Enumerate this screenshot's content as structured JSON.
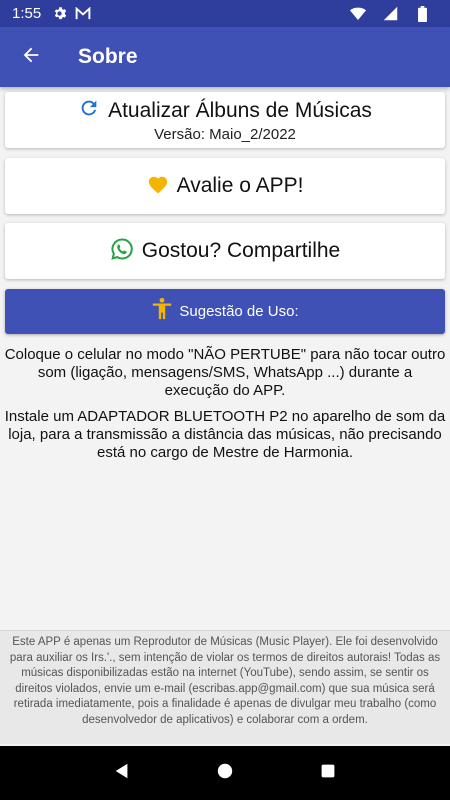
{
  "status_bar": {
    "time": "1:55",
    "icons_left": [
      "gear-icon",
      "gmail-icon"
    ],
    "icons_right": [
      "wifi-icon",
      "signal-icon",
      "battery-icon"
    ]
  },
  "app_bar": {
    "title": "Sobre",
    "back_icon": "arrow-back-icon",
    "color": "#3f51b5"
  },
  "cards": {
    "update": {
      "icon": "refresh-icon",
      "label": "Atualizar Álbuns de Músicas",
      "version": "Versão: Maio_2/2022"
    },
    "rate": {
      "icon": "heart-icon",
      "label": "Avalie o APP!"
    },
    "share": {
      "icon": "whatsapp-icon",
      "label": "Gostou? Compartilhe"
    }
  },
  "suggestion": {
    "icon": "accessibility-icon",
    "label": "Sugestão de Uso:"
  },
  "paragraphs": [
    "Coloque o celular no modo \"NÃO PERTUBE\" para não tocar outro som (ligação, mensagens/SMS, WhatsApp ...) durante a execução do APP.",
    "Instale um ADAPTADOR BLUETOOTH P2 no aparelho de som da loja, para a transmissão a distância das músicas, não precisando está no cargo de Mestre de Harmonia."
  ],
  "disclaimer": "Este APP é apenas um Reprodutor de Músicas (Music Player). Ele foi desenvolvido para auxiliar os Irs.'., sem intenção de violar os termos de direitos autorais! Todas as músicas disponibilizadas estão na internet (YouTube), sendo assim, se sentir os direitos violados, envie um e-mail (escribas.app@gmail.com) que sua música será retirada imediatamente, pois a finalidade é apenas de divulgar meu trabalho (como desenvolvedor de aplicativos) e colaborar com a ordem.",
  "nav_bar": {
    "buttons": [
      "back-nav-icon",
      "home-nav-icon",
      "recents-nav-icon"
    ]
  }
}
